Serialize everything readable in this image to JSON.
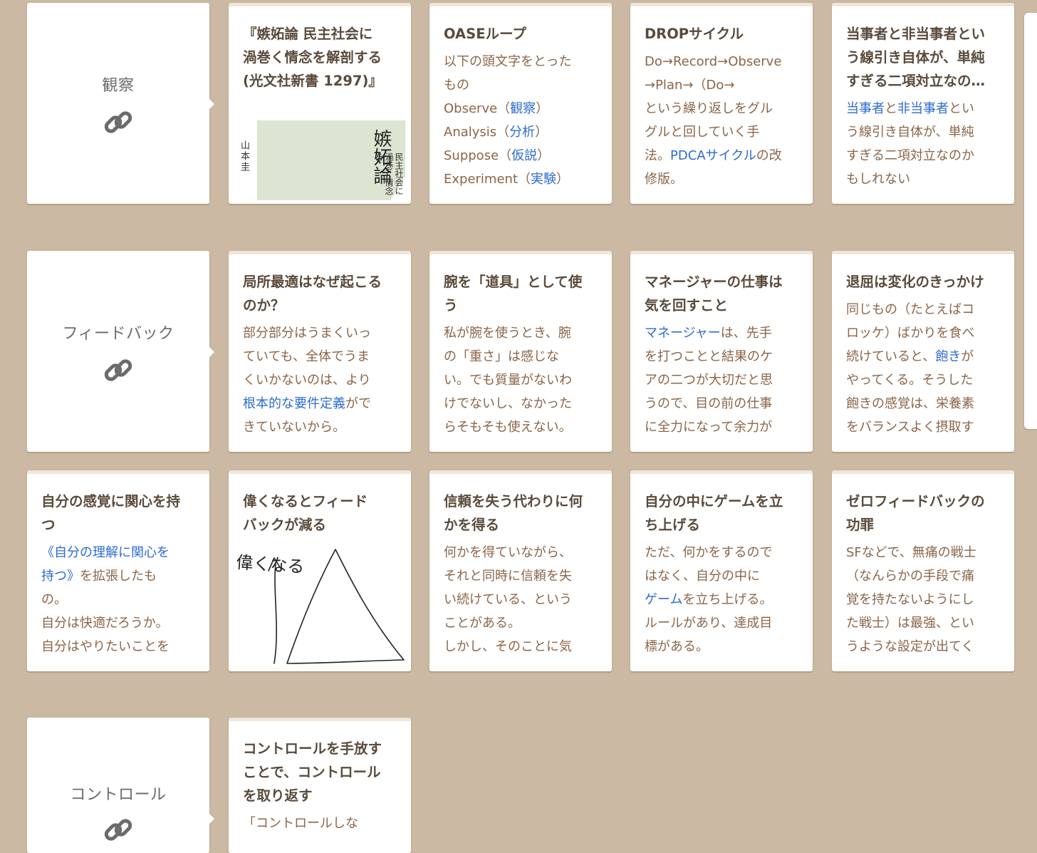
{
  "hubs": [
    {
      "title": "観察",
      "icon": "link-icon"
    },
    {
      "title": "フィードバック",
      "icon": "link-icon"
    },
    {
      "title": "コントロール",
      "icon": "link-icon"
    }
  ],
  "row1": {
    "book": {
      "title_lines": [
        "『嫉妬論 民主社会に",
        "渦巻く情念を解剖する",
        "(光文社新書 1297)』"
      ],
      "cover_title": "嫉妬論",
      "cover_sub": "民主社会に渦巻く情念を",
      "cover_author": "山本圭"
    },
    "oase": {
      "title": "OASEループ",
      "l1": "以下の頭文字をとった",
      "l2": "もの",
      "l3a": "Observe（",
      "l3b": "観察",
      "l3c": "）",
      "l4a": "Analysis（",
      "l4b": "分析",
      "l4c": "）",
      "l5a": "Suppose（",
      "l5b": "仮説",
      "l5c": "）",
      "l6a": "Experiment（",
      "l6b": "実験",
      "l6c": "）"
    },
    "drop": {
      "title": "DROPサイクル",
      "l1": "Do→Record→Observe",
      "l2": "→Plan→（Do→",
      "l3": "という繰り返しをグル",
      "l4": "グルと回していく手",
      "l5a": "法。",
      "l5b": "PDCAサイクル",
      "l5c": "の改",
      "l6": "修版。"
    },
    "toujisha": {
      "title_lines": [
        "当事者と非当事者とい",
        "う線引き自体が、単純",
        "すぎる二項対立なの…"
      ],
      "l1a": "当事者",
      "l1b": "と",
      "l1c": "非当事者",
      "l1d": "とい",
      "l2": "う線引き自体が、単純",
      "l3": "すぎる二項対立なのか",
      "l4": "もしれない"
    }
  },
  "row2": {
    "kyokusho": {
      "title_lines": [
        "局所最適はなぜ起こる",
        "のか？"
      ],
      "l1": "部分部分はうまくいっ",
      "l2": "ていても、全体でうま",
      "l3": "くいかないのは、より",
      "l4a": "根本的な要件定義",
      "l4b": "がで",
      "l5": "きていないから。"
    },
    "ude": {
      "title_lines": [
        "腕を「道具」として使",
        "う"
      ],
      "l1": "私が腕を使うとき、腕",
      "l2": "の「重さ」は感じな",
      "l3": "い。でも質量がないわ",
      "l4": "けでないし、なかった",
      "l5": "らそもそも使えない。"
    },
    "manager": {
      "title_lines": [
        "マネージャーの仕事は",
        "気を回すこと"
      ],
      "l1a": "マネージャー",
      "l1b": "は、先手",
      "l2": "を打つことと結果のケ",
      "l3": "アの二つが大切だと思",
      "l4": "うので、目の前の仕事",
      "l5": "に全力になって余力が"
    },
    "taikutsu": {
      "title": "退屈は変化のきっかけ",
      "l1": "同じもの（たとえばコ",
      "l2": "ロッケ）ばかりを食べ",
      "l3a": "続けていると、",
      "l3b": "飽き",
      "l3c": "が",
      "l4": "やってくる。そうした",
      "l5": "飽きの感覚は、栄養素",
      "l6": "をバランスよく摂取す"
    }
  },
  "row3": {
    "jibun": {
      "title_lines": [
        "自分の感覚に関心を持",
        "つ"
      ],
      "l1": "《自分の理解に関心を",
      "l2a": "持つ》",
      "l2b": "を拡張したも",
      "l3": "の。",
      "l4": "自分は快適だろうか。",
      "l5": "自分はやりたいことを"
    },
    "eraku": {
      "title_lines": [
        "偉くなるとフィード",
        "バックが減る"
      ],
      "sketch_label": "偉くなる"
    },
    "shinrai": {
      "title_lines": [
        "信頼を失う代わりに何",
        "かを得る"
      ],
      "l1": "何かを得ていながら、",
      "l2": "それと同時に信頼を失",
      "l3": "い続けている、という",
      "l4": "ことがある。",
      "l5": "しかし、そのことに気"
    },
    "game": {
      "title_lines": [
        "自分の中にゲームを立",
        "ち上げる"
      ],
      "l1": "ただ、何かをするので",
      "l2": "はなく、自分の中に",
      "l3a": "ゲーム",
      "l3b": "を立ち上げる。",
      "l4": "ルールがあり、達成目",
      "l5": "標がある。"
    },
    "zero": {
      "title_lines": [
        "ゼロフィードバックの",
        "功罪"
      ],
      "l1": "SFなどで、無痛の戦士",
      "l2": "（なんらかの手段で痛",
      "l3": "覚を持たないようにし",
      "l4": "た戦士）は最強、とい",
      "l5": "うような設定が出てく"
    }
  },
  "row4": {
    "control": {
      "title_lines": [
        "コントロールを手放す",
        "ことで、コントロール",
        "を取り返す"
      ],
      "l1": "「コントロールしな"
    }
  },
  "colors": {
    "background": "#cbb9a3",
    "title": "#5a4a3b",
    "body": "#8b6548",
    "link": "#2d6ccf"
  }
}
